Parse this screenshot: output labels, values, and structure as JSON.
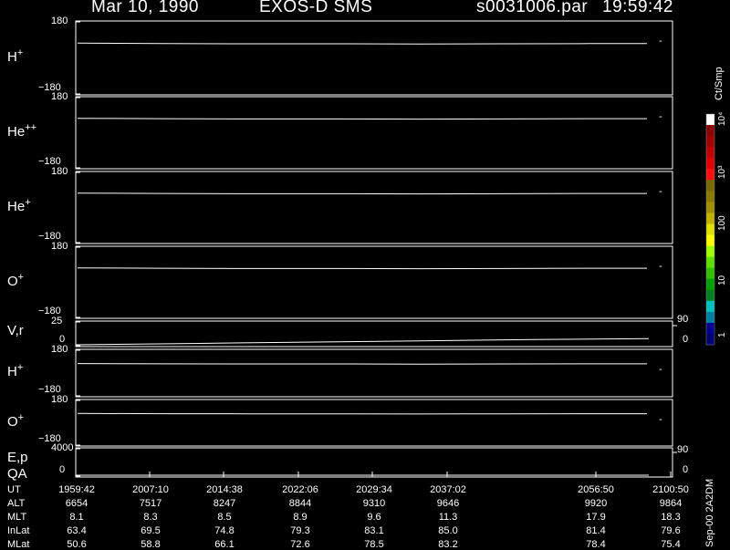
{
  "header": {
    "date": "Mar 10, 1990",
    "mission": "EXOS-D SMS",
    "file": "s0031006.par",
    "time": "19:59:42"
  },
  "colorbar": {
    "unit": "Ct/Smp",
    "tick_labels": [
      "10⁴",
      "10³",
      "100",
      "10",
      "1"
    ],
    "colors": [
      "#ffffff",
      "#8b0000",
      "#a00000",
      "#c00000",
      "#e00000",
      "#ff1010",
      "#7a6a00",
      "#8a7a00",
      "#a09000",
      "#c0b000",
      "#e0e000",
      "#ffff00",
      "#a0ff00",
      "#60e000",
      "#30c000",
      "#00a000",
      "#008020",
      "#00c0c0",
      "#0080a0",
      "#000090",
      "#000070"
    ]
  },
  "footer_label": "Sep-00  2A2DM",
  "chart_data": {
    "type": "line",
    "panels": [
      {
        "label": "H",
        "sup": "+",
        "ytop": "180",
        "ybot": "−180",
        "ylim": [
          -180,
          180
        ],
        "right": "-",
        "series": [
          {
            "x": [
              0,
              0.15,
              0.3,
              0.45,
              0.6,
              0.75,
              0.9,
              1.0
            ],
            "y": [
              0,
              -2,
              -3,
              -3,
              -4,
              -3,
              -2,
              -2
            ]
          }
        ]
      },
      {
        "label": "He",
        "sup": "++",
        "ytop": "180",
        "ybot": "−180",
        "ylim": [
          -180,
          180
        ],
        "right": "-",
        "series": [
          {
            "x": [
              0,
              0.15,
              0.3,
              0.45,
              0.6,
              0.75,
              0.9,
              1.0
            ],
            "y": [
              0,
              -2,
              -3,
              -3,
              -4,
              -3,
              -2,
              -2
            ]
          }
        ]
      },
      {
        "label": "He",
        "sup": "+",
        "ytop": "180",
        "ybot": "−180",
        "ylim": [
          -180,
          180
        ],
        "right": "-",
        "series": [
          {
            "x": [
              0,
              0.15,
              0.3,
              0.45,
              0.6,
              0.75,
              0.9,
              1.0
            ],
            "y": [
              0,
              -2,
              -3,
              -3,
              -4,
              -3,
              -2,
              -2
            ]
          }
        ]
      },
      {
        "label": "O",
        "sup": "+",
        "ytop": "180",
        "ybot": "−180",
        "ylim": [
          -180,
          180
        ],
        "right": "-",
        "series": [
          {
            "x": [
              0,
              0.15,
              0.3,
              0.45,
              0.6,
              0.75,
              0.9,
              1.0
            ],
            "y": [
              0,
              -2,
              -3,
              -3,
              -4,
              -3,
              -2,
              -2
            ]
          }
        ]
      },
      {
        "label": "V,r",
        "sup": "",
        "ytop": "25",
        "ybot": "0",
        "ylim": [
          0,
          25
        ],
        "rtop": "90",
        "rbot": "0",
        "series": [
          {
            "x": [
              0,
              0.2,
              0.4,
              0.6,
              0.8,
              1.0
            ],
            "y": [
              0,
              1.5,
              3,
              4.5,
              6,
              7
            ]
          }
        ]
      },
      {
        "label": "H",
        "sup": "+",
        "ytop": "180",
        "ybot": "−180",
        "ylim": [
          -180,
          180
        ],
        "right": "-",
        "series": [
          {
            "x": [
              0,
              0.15,
              0.3,
              0.45,
              0.6,
              0.75,
              0.9,
              1.0
            ],
            "y": [
              0,
              -2,
              -3,
              -3,
              -4,
              -3,
              -2,
              -2
            ]
          }
        ]
      },
      {
        "label": "O",
        "sup": "+",
        "ytop": "180",
        "ybot": "−180",
        "ylim": [
          -180,
          180
        ],
        "right": "-",
        "series": [
          {
            "x": [
              0,
              0.15,
              0.3,
              0.45,
              0.6,
              0.75,
              0.9,
              1.0
            ],
            "y": [
              0,
              -2,
              -3,
              -3,
              -4,
              -3,
              -2,
              -2
            ]
          }
        ]
      },
      {
        "label": "E,p",
        "sup": "",
        "label2": "QA",
        "ytop": "4000",
        "ybot": "0",
        "ylim": [
          0,
          4000
        ],
        "rtop": "90",
        "rbot": "0",
        "series": [
          {
            "x": [
              0,
              1.0
            ],
            "y": [
              0,
              0
            ]
          }
        ]
      }
    ],
    "table": {
      "rows": [
        {
          "name": "UT",
          "values": [
            "1959:42",
            "2007:10",
            "2014:38",
            "2022:06",
            "2029:34",
            "2037:02",
            "2056:50",
            "2100:50"
          ]
        },
        {
          "name": "ALT",
          "values": [
            "6654",
            "7517",
            "8247",
            "8844",
            "9310",
            "9646",
            "9920",
            "9864"
          ]
        },
        {
          "name": "MLT",
          "values": [
            "8.1",
            "8.3",
            "8.5",
            "8.9",
            "9.6",
            "11.3",
            "17.9",
            "18.3"
          ]
        },
        {
          "name": "InLat",
          "values": [
            "63.4",
            "69.5",
            "74.8",
            "79.3",
            "83.1",
            "85.0",
            "81.4",
            "79.6"
          ]
        },
        {
          "name": "MLat",
          "values": [
            "50.6",
            "58.8",
            "66.1",
            "72.6",
            "78.5",
            "83.2",
            "78.4",
            "75.4"
          ]
        }
      ]
    }
  }
}
